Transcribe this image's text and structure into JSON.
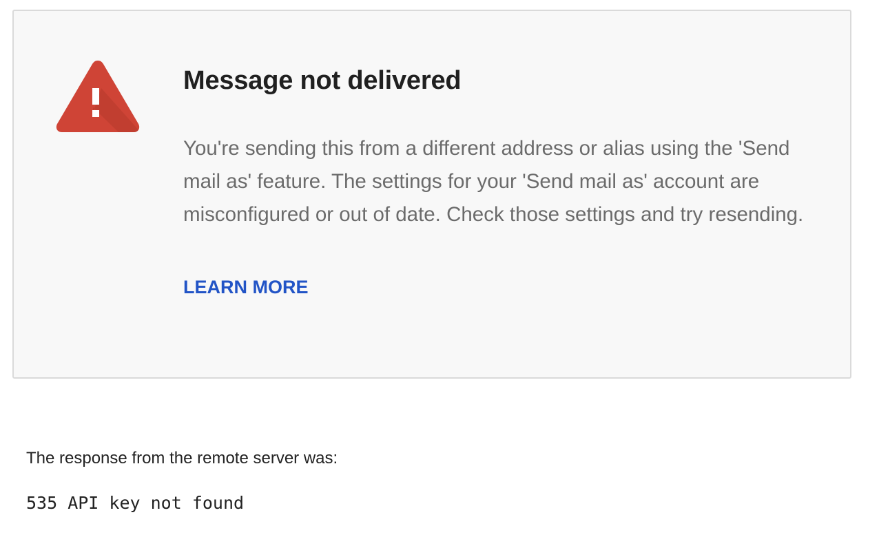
{
  "notice": {
    "icon": "warning-triangle-icon",
    "icon_color": "#cf4436",
    "title": "Message not delivered",
    "body": "You're sending this from a different address or alias using the 'Send mail as' feature. The settings for your 'Send mail as' account are misconfigured or out of date. Check those settings and try resending.",
    "learn_more_label": "LEARN MORE",
    "link_color": "#2254c6"
  },
  "response": {
    "label": "The response from the remote server was:",
    "code": "535 API key not found"
  }
}
